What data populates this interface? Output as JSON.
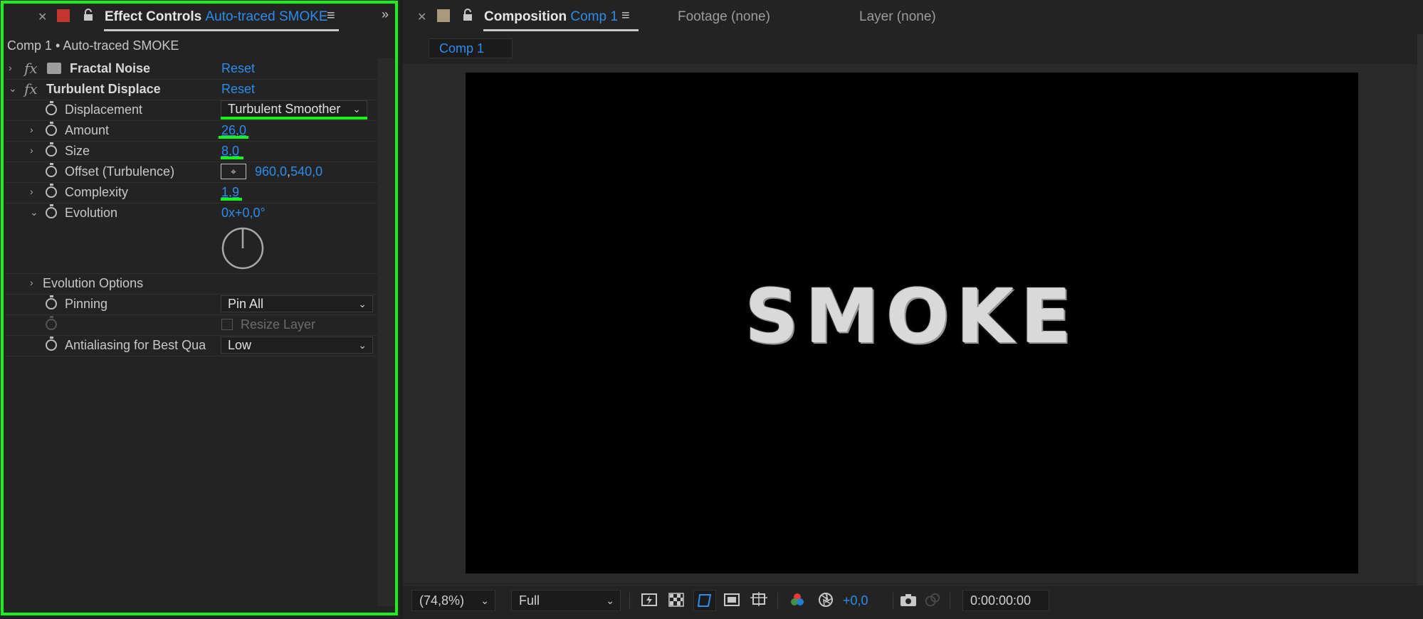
{
  "left_panel": {
    "tab_title": "Effect Controls",
    "tab_layer": "Auto-traced SMOKE",
    "subheader": "Comp 1 • Auto-traced SMOKE",
    "effects": [
      {
        "name": "Fractal Noise",
        "reset": "Reset"
      },
      {
        "name": "Turbulent Displace",
        "reset": "Reset"
      }
    ],
    "properties": {
      "displacement": {
        "label": "Displacement",
        "value": "Turbulent Smoother"
      },
      "amount": {
        "label": "Amount",
        "value": "26,0"
      },
      "size": {
        "label": "Size",
        "value": "8,0"
      },
      "offset": {
        "label": "Offset (Turbulence)",
        "x": "960,0",
        "y": "540,0"
      },
      "complexity": {
        "label": "Complexity",
        "value": "1,9"
      },
      "evolution": {
        "label": "Evolution",
        "value": "0x+0,0°"
      },
      "evolution_options": {
        "label": "Evolution Options"
      },
      "pinning": {
        "label": "Pinning",
        "value": "Pin All"
      },
      "resize_layer": {
        "label": "Resize Layer"
      },
      "antialiasing": {
        "label": "Antialiasing for Best Qua",
        "value": "Low"
      }
    },
    "highlight_color": "#19f219"
  },
  "right_panel": {
    "composition_tab": "Composition",
    "composition_name": "Comp 1",
    "footage_tab": "Footage (none)",
    "layer_tab": "Layer (none)",
    "sub_tab": "Comp 1",
    "canvas_text": "SMOKE",
    "toolbar": {
      "zoom": "(74,8%)",
      "resolution": "Full",
      "exposure": "+0,0",
      "timecode": "0:00:00:00"
    }
  },
  "accent_color": "#2d8ceb"
}
